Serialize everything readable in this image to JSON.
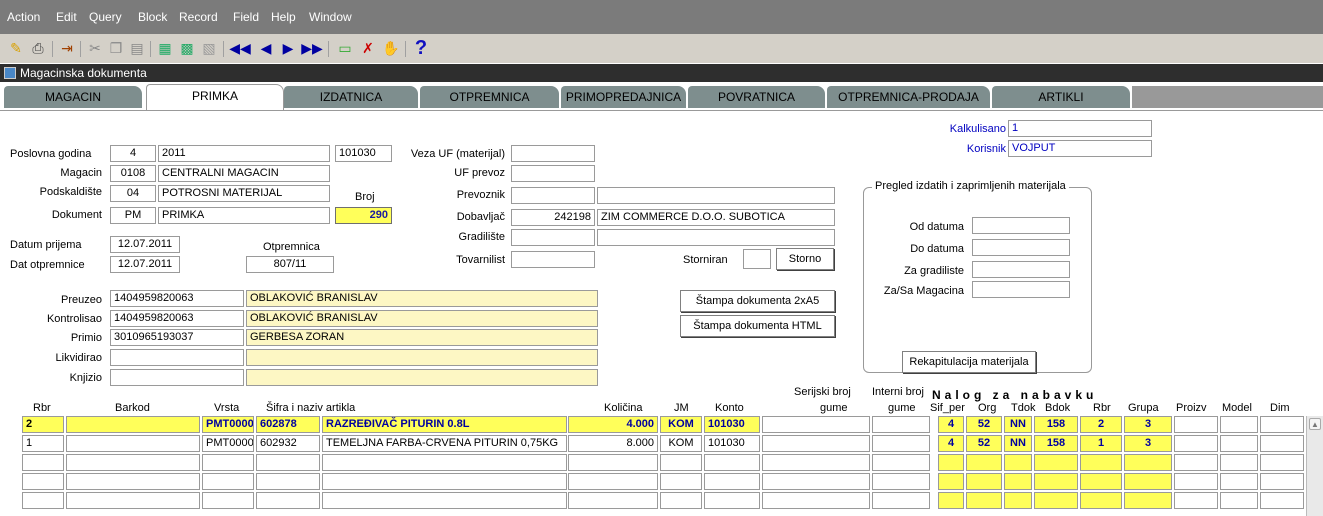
{
  "menu": [
    "Action",
    "Edit",
    "Query",
    "Block",
    "Record",
    "Field",
    "Help",
    "Window"
  ],
  "window_title": "Magacinska dokumenta",
  "tabs": [
    "MAGACIN",
    "PRIMKA",
    "IZDATNICA",
    "OTPREMNICA",
    "PRIMOPREDAJNICA",
    "POVRATNICA",
    "OTPREMNICA-PRODAJA",
    "ARTIKLI"
  ],
  "form": {
    "poslovna_godina_label": "Poslovna godina",
    "poslovna_godina_code": "4",
    "poslovna_godina_year": "2011",
    "konto": "101030",
    "magacin_label": "Magacin",
    "magacin_code": "0108",
    "magacin_name": "CENTRALNI MAGACIN",
    "podskladiste_label": "Podskaldište",
    "podskladiste_code": "04",
    "podskladiste_name": "POTROSNI MATERIJAL",
    "broj_label": "Broj",
    "broj": "290",
    "dokument_label": "Dokument",
    "dokument_code": "PM",
    "dokument_name": "PRIMKA",
    "datum_prijema_label": "Datum prijema",
    "datum_prijema": "12.07.2011",
    "dat_otpremnice_label": "Dat otpremnice",
    "dat_otpremnice": "12.07.2011",
    "otpremnica_label": "Otpremnica",
    "otpremnica": "807/11",
    "veza_uf_label": "Veza UF (materijal)",
    "uf_prevoz_label": "UF prevoz",
    "prevoznik_label": "Prevoznik",
    "dobavljac_label": "Dobavljač",
    "dobavljac_code": "242198",
    "dobavljac_name": "ZIM COMMERCE D.O.O. SUBOTICA",
    "gradiliste_label": "Gradilište",
    "tovarnilist_label": "Tovarnilist",
    "storniran_label": "Storniran",
    "storno_btn": "Storno",
    "kalkulisano_label": "Kalkulisano",
    "kalkulisano": "1",
    "korisnik_label": "Korisnik",
    "korisnik": "VOJPUT",
    "preuzeo_label": "Preuzeo",
    "preuzeo_jmbg": "1404959820063",
    "preuzeo_name": "OBLAKOVIĆ BRANISLAV",
    "kontrolisao_label": "Kontrolisao",
    "kontrolisao_jmbg": "1404959820063",
    "kontrolisao_name": "OBLAKOVIĆ BRANISLAV",
    "primio_label": "Primio",
    "primio_jmbg": "3010965193037",
    "primio_name": "GERBESA ZORAN",
    "likvidirao_label": "Likvidirao",
    "knjizio_label": "Knjizio",
    "stampa_2xa5": "Štampa dokumenta 2xA5",
    "stampa_html": "Štampa dokumenta HTML",
    "pregled_title": "Pregled izdatih i zaprimljenih materijala",
    "od_datuma_label": "Od datuma",
    "do_datuma_label": "Do datuma",
    "za_gradiliste_label": "Za gradiliste",
    "za_sa_magacina_label": "Za/Sa Magacina",
    "rekapitulacija_btn": "Rekapitulacija materijala"
  },
  "grid": {
    "nalog_title": "Nalog za nabavku",
    "headers": {
      "rbr": "Rbr",
      "barkod": "Barkod",
      "vrsta": "Vrsta",
      "sifra": "Šifra i naziv artikla",
      "kolicina": "Količina",
      "jm": "JM",
      "konto": "Konto",
      "serijski1": "Serijski broj",
      "serijski2": "gume",
      "interni1": "Interni broj",
      "interni2": "gume",
      "sif_per": "Sif_per",
      "org": "Org",
      "tdok": "Tdok",
      "bdok": "Bdok",
      "rbr2": "Rbr",
      "grupa": "Grupa",
      "proizv": "Proizv",
      "model": "Model",
      "dim": "Dim"
    },
    "rows": [
      {
        "rbr": "2",
        "barkod": "",
        "vrsta": "PMT0000",
        "sifra": "602878",
        "naziv": "RAZREĐIVAČ PITURIN  0.8L",
        "kolicina": "4.000",
        "jm": "KOM",
        "konto": "101030",
        "sif_per": "4",
        "org": "52",
        "tdok": "NN",
        "bdok": "158",
        "rbr2": "2",
        "grupa": "3"
      },
      {
        "rbr": "1",
        "barkod": "",
        "vrsta": "PMT0000",
        "sifra": "602932",
        "naziv": "TEMELJNA FARBA-CRVENA PITURIN 0,75KG",
        "kolicina": "8.000",
        "jm": "KOM",
        "konto": "101030",
        "sif_per": "4",
        "org": "52",
        "tdok": "NN",
        "bdok": "158",
        "rbr2": "1",
        "grupa": "3"
      }
    ]
  },
  "toolbar_icons": [
    "open-icon",
    "print-icon",
    "exit-icon",
    "cut-icon",
    "copy-icon",
    "paste-icon",
    "enter-query-icon",
    "execute-query-icon",
    "cancel-query-icon",
    "first-record-icon",
    "prev-record-icon",
    "next-record-icon",
    "last-record-icon",
    "insert-record-icon",
    "delete-record-icon",
    "lock-record-icon",
    "help-icon"
  ]
}
